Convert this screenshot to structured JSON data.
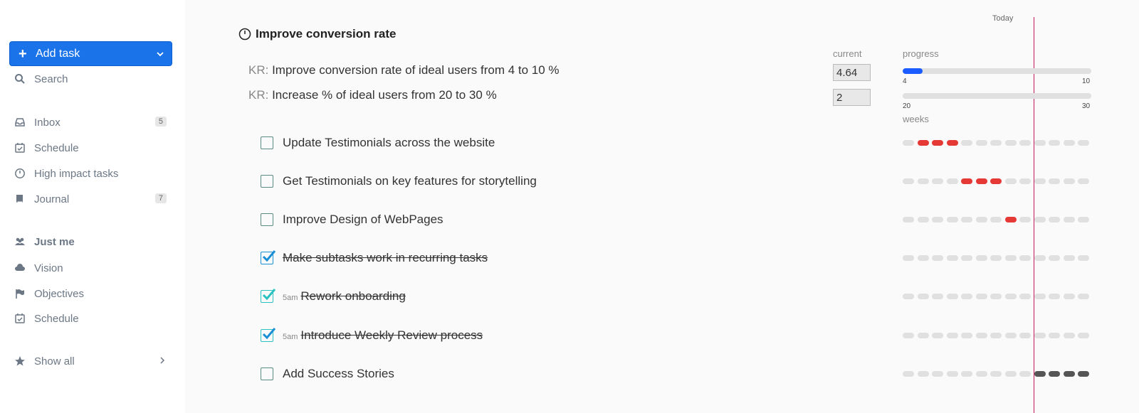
{
  "sidebar": {
    "add_task_label": "Add task",
    "search_label": "Search",
    "items": [
      {
        "label": "Inbox",
        "badge": "5",
        "icon": "inbox-icon"
      },
      {
        "label": "Schedule",
        "badge": "",
        "icon": "calendar-check-icon"
      },
      {
        "label": "High impact tasks",
        "badge": "",
        "icon": "clock-icon"
      },
      {
        "label": "Journal",
        "badge": "7",
        "icon": "book-icon"
      }
    ],
    "group_label": "Just me",
    "group_items": [
      {
        "label": "Vision",
        "icon": "cloud-icon"
      },
      {
        "label": "Objectives",
        "icon": "flag-icon"
      },
      {
        "label": "Schedule",
        "icon": "calendar-check-icon"
      }
    ],
    "show_all_label": "Show all"
  },
  "main": {
    "today_label": "Today",
    "objective_title": "Improve conversion rate",
    "col_current": "current",
    "col_progress": "progress",
    "col_weeks": "weeks",
    "key_results": [
      {
        "prefix": "KR:",
        "text": "Improve conversion rate of ideal users from 4 to 10 %",
        "current": "4.64",
        "min": "4",
        "max": "10",
        "progress": 0.107
      },
      {
        "prefix": "KR:",
        "text": "Increase % of ideal users from 20 to 30 %",
        "current": "2",
        "min": "20",
        "max": "30",
        "progress": 0
      }
    ],
    "tasks": [
      {
        "text": "Update Testimonials across the website",
        "done": false,
        "time": "",
        "weeks": [
          "",
          "red",
          "red",
          "red",
          "",
          "",
          "",
          "",
          "",
          "",
          "",
          "",
          ""
        ]
      },
      {
        "text": "Get Testimonials on key features for storytelling",
        "done": false,
        "time": "",
        "weeks": [
          "",
          "",
          "",
          "",
          "red",
          "red",
          "red",
          "",
          "",
          "",
          "",
          "",
          ""
        ]
      },
      {
        "text": "Improve Design of WebPages",
        "done": false,
        "time": "",
        "weeks": [
          "",
          "",
          "",
          "",
          "",
          "",
          "",
          "red",
          "",
          "",
          "",
          "",
          ""
        ]
      },
      {
        "text": "Make subtasks work in recurring tasks",
        "done": true,
        "time": "",
        "weeks": [
          "",
          "",
          "",
          "",
          "",
          "",
          "",
          "",
          "",
          "",
          "",
          "",
          ""
        ]
      },
      {
        "text": "Rework onboarding",
        "done": true,
        "time": "5am",
        "weeks": [
          "",
          "",
          "",
          "",
          "",
          "",
          "",
          "",
          "",
          "",
          "",
          "",
          ""
        ]
      },
      {
        "text": "Introduce Weekly Review process",
        "done": true,
        "time": "5am",
        "weeks": [
          "",
          "",
          "",
          "",
          "",
          "",
          "",
          "",
          "",
          "",
          "",
          "",
          ""
        ]
      },
      {
        "text": "Add Success Stories",
        "done": false,
        "time": "",
        "weeks": [
          "",
          "",
          "",
          "",
          "",
          "",
          "",
          "",
          "",
          "dark",
          "dark",
          "dark",
          "dark"
        ]
      }
    ]
  }
}
